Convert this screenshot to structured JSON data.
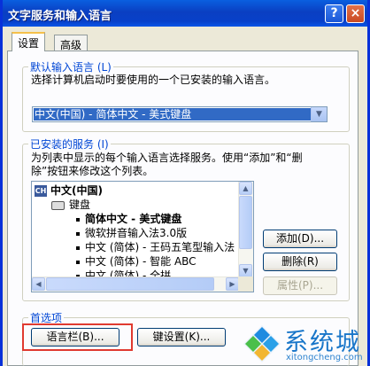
{
  "window": {
    "title": "文字服务和输入语言",
    "help_glyph": "?",
    "close_glyph": "×"
  },
  "tabs": [
    {
      "label": "设置",
      "active": true
    },
    {
      "label": "高级",
      "active": false
    }
  ],
  "default_language": {
    "group_label": "默认输入语言 (L)",
    "description": "选择计算机启动时要使用的一个已安装的输入语言。",
    "selected": "中文(中国) - 简体中文 - 美式键盘"
  },
  "installed_services": {
    "group_label": "已安装的服务 (I)",
    "description_line1": "为列表中显示的每个输入语言选择服务。使用“添加”和“删",
    "description_line2": "除”按钮来修改这个列表。",
    "language": {
      "badge": "CH",
      "label": "中文(中国)"
    },
    "category": "键盘",
    "items": [
      {
        "label": "简体中文 - 美式键盘",
        "bold": true
      },
      {
        "label": "微软拼音输入法3.0版",
        "bold": false
      },
      {
        "label": "中文 (简体) - 王码五笔型输入法",
        "bold": false
      },
      {
        "label": "中文 (简体) - 智能 ABC",
        "bold": false
      },
      {
        "label": "中文 (简体) - 全拼",
        "bold": false
      }
    ],
    "buttons": {
      "add": "添加(D)...",
      "remove": "删除(R)",
      "properties": "属性(P)..."
    }
  },
  "preferences": {
    "group_label": "首选项",
    "language_bar_button": "语言栏(B)...",
    "key_settings_button": "键设置(K)..."
  },
  "watermark": {
    "text": "系统城",
    "url": "xitongcheng.com"
  },
  "colors": {
    "title_blue": "#0a3fc2",
    "selection": "#316ac5",
    "highlight_red": "#e03a30",
    "group_label_blue": "#0046d5"
  }
}
